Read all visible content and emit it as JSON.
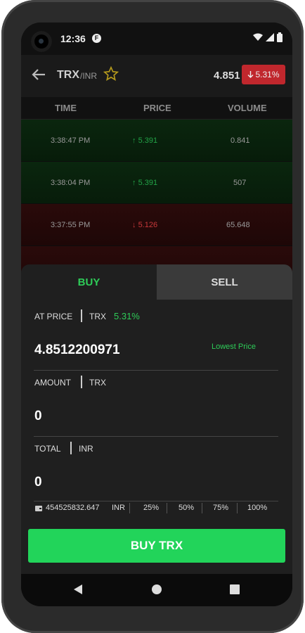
{
  "status": {
    "time": "12:36",
    "notification_glyph": "F"
  },
  "header": {
    "pair": "TRX",
    "quote": "/INR",
    "last_price": "4.851",
    "change": "5.31%",
    "change_color": "#c0272d"
  },
  "table": {
    "columns": [
      "TIME",
      "PRICE",
      "VOLUME"
    ],
    "rows": [
      {
        "time": "3:38:47 PM",
        "price": "5.391",
        "volume": "0.841",
        "direction": "up"
      },
      {
        "time": "3:38:04 PM",
        "price": "5.391",
        "volume": "507",
        "direction": "up"
      },
      {
        "time": "3:37:55 PM",
        "price": "5.126",
        "volume": "65.648",
        "direction": "down"
      }
    ]
  },
  "sheet": {
    "tabs": {
      "buy": "BUY",
      "sell": "SELL"
    },
    "at_price": {
      "label": "AT PRICE",
      "unit": "TRX",
      "change": "5.31%",
      "value": "4.8512200971",
      "hint": "Lowest Price"
    },
    "amount": {
      "label": "AMOUNT",
      "unit": "TRX",
      "value": "0"
    },
    "total": {
      "label": "TOTAL",
      "unit": "INR",
      "value": "0"
    },
    "balance": {
      "icon": "wallet-icon",
      "value": "454525832.647",
      "unit": "INR",
      "percents": [
        "25%",
        "50%",
        "75%",
        "100%"
      ]
    },
    "buy_button": "BUY TRX"
  },
  "colors": {
    "accent_green": "#22d45a",
    "up": "#22a347",
    "down": "#c8383a"
  }
}
